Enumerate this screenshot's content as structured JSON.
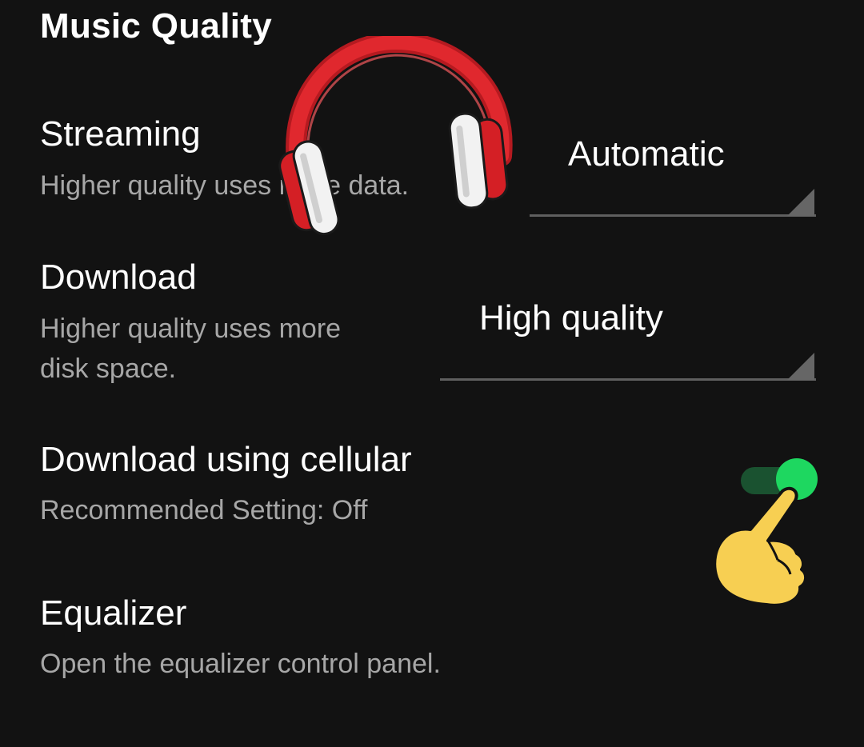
{
  "settings": {
    "section_title": "Music Quality",
    "streaming": {
      "title": "Streaming",
      "description": "Higher quality uses more data.",
      "value": "Automatic"
    },
    "download": {
      "title": "Download",
      "description_line1": "Higher quality uses more",
      "description_line2": "disk space.",
      "value": "High quality"
    },
    "download_cellular": {
      "title": "Download using cellular",
      "description": "Recommended Setting: Off",
      "enabled": true
    },
    "equalizer": {
      "title": "Equalizer",
      "description": "Open the equalizer control panel."
    }
  },
  "colors": {
    "background": "#121212",
    "text_primary": "#ffffff",
    "text_secondary": "#a7a7a7",
    "toggle_on": "#1ed760",
    "toggle_track": "#1a5230",
    "headphones": "#e0282e",
    "hand": "#f7cf52"
  },
  "icons": {
    "headphones": "headphones-icon",
    "hand": "pointing-hand-icon",
    "dropdown_arrow": "dropdown-arrow-icon"
  }
}
